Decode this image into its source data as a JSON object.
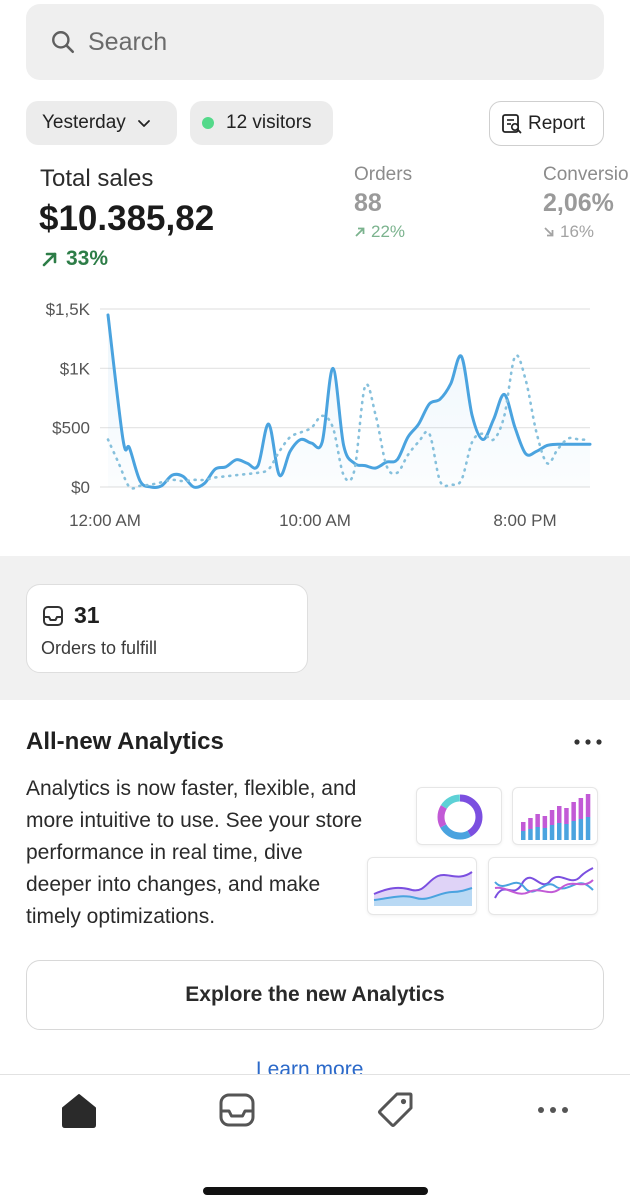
{
  "search": {
    "placeholder": "Search",
    "icon": "search-icon"
  },
  "filters": {
    "date_label": "Yesterday",
    "visitors_label": "12 visitors",
    "visitor_dot_color": "#54d98a",
    "report_label": "Report"
  },
  "total_sales": {
    "label": "Total sales",
    "value": "$10.385,82",
    "change": "33%",
    "direction": "up",
    "color": "#2d7d47"
  },
  "metrics": [
    {
      "label": "Orders",
      "value": "88",
      "change": "22%",
      "direction": "up"
    },
    {
      "label": "Conversio",
      "value": "2,06%",
      "change": "16%",
      "direction": "down"
    }
  ],
  "chart_data": {
    "type": "line",
    "y_ticks": [
      "$1,5K",
      "$1K",
      "$500",
      "$0"
    ],
    "x_ticks": [
      "12:00 AM",
      "10:00 AM",
      "8:00 PM"
    ],
    "ylim": [
      0,
      1500
    ],
    "x_range": [
      0,
      22.5
    ],
    "grid": true,
    "series": [
      {
        "style": "solid",
        "color": "#4aa3df",
        "x": [
          0,
          0.7,
          1,
          1.5,
          2,
          2.5,
          3,
          3.5,
          4,
          4.5,
          5,
          5.5,
          6,
          6.5,
          7,
          7.5,
          8,
          8.5,
          9,
          9.5,
          10,
          10.5,
          11,
          11.5,
          12,
          12.5,
          13,
          13.5,
          14,
          14.5,
          15,
          15.5,
          16,
          16.5,
          17,
          17.5,
          18,
          18.5,
          19,
          19.5,
          20,
          20.5,
          21,
          21.5,
          22,
          22.5
        ],
        "values": [
          1450,
          400,
          330,
          50,
          0,
          10,
          100,
          90,
          0,
          30,
          150,
          170,
          230,
          200,
          180,
          530,
          100,
          300,
          400,
          370,
          380,
          1000,
          350,
          200,
          180,
          160,
          210,
          230,
          420,
          530,
          700,
          740,
          870,
          1100,
          600,
          400,
          570,
          780,
          500,
          280,
          300,
          350,
          360,
          360,
          360,
          360
        ]
      },
      {
        "style": "dotted",
        "color": "#86c0dc",
        "x": [
          0,
          0.5,
          1,
          1.5,
          2,
          2.5,
          3,
          3.5,
          4,
          4.5,
          5,
          5.5,
          6,
          6.5,
          7,
          7.5,
          8,
          8.5,
          9,
          9.5,
          10,
          10.5,
          11,
          11.5,
          12,
          12.5,
          13,
          13.5,
          14,
          14.5,
          15,
          15.5,
          16,
          16.5,
          17,
          17.5,
          18,
          18.5,
          19,
          19.5,
          20,
          20.5,
          21,
          21.5,
          22,
          22.5
        ],
        "values": [
          400,
          200,
          0,
          10,
          20,
          40,
          60,
          50,
          60,
          60,
          80,
          90,
          100,
          110,
          120,
          150,
          300,
          420,
          460,
          500,
          600,
          500,
          100,
          140,
          850,
          600,
          180,
          120,
          270,
          380,
          450,
          50,
          20,
          60,
          380,
          450,
          400,
          600,
          1100,
          900,
          460,
          200,
          320,
          410,
          400,
          400
        ]
      }
    ]
  },
  "fulfill_card": {
    "count": "31",
    "label": "Orders to fulfill",
    "icon": "inbox-icon"
  },
  "analytics": {
    "title": "All-new Analytics",
    "body": "Analytics is now faster, flexible, and more intuitive to use. See your store performance in real time, dive deeper into changes, and make timely optimizations.",
    "explore_label": "Explore the new Analytics",
    "learn_more": "Learn more"
  },
  "tabbar": {
    "items": [
      {
        "icon": "home-icon",
        "active": true
      },
      {
        "icon": "inbox-icon",
        "active": false
      },
      {
        "icon": "tag-icon",
        "active": false
      },
      {
        "icon": "more-icon",
        "active": false
      }
    ]
  }
}
